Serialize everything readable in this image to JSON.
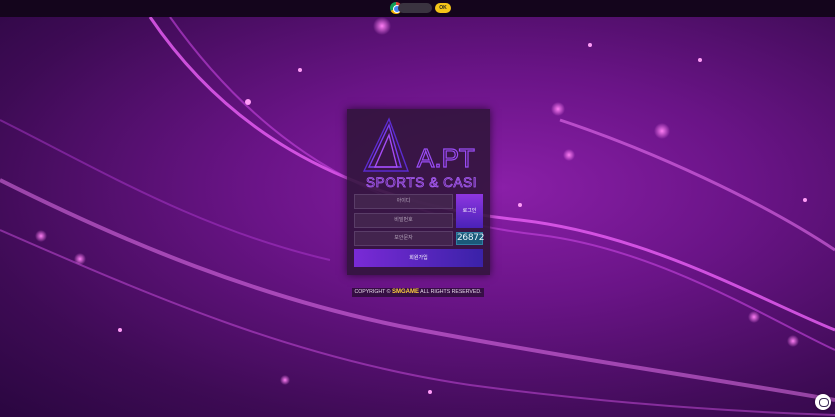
{
  "topbar": {
    "ok_label": "OK"
  },
  "logo": {
    "mark": "A.PT",
    "tagline": "SPORTS & CASINO"
  },
  "login_form": {
    "username_placeholder": "아이디",
    "password_placeholder": "비밀번호",
    "captcha_placeholder": "보안문자",
    "login_label": "로그인",
    "captcha_code": "26872",
    "signup_label": "회원가입"
  },
  "footer": {
    "copyright_prefix": "COPYRIGHT ©",
    "brand": "SMGAME",
    "copyright_suffix": "ALL RIGHTS RESERVED."
  },
  "colors": {
    "accent": "#8e36e0",
    "brand": "#ffd23c",
    "background": "#6a1487"
  }
}
